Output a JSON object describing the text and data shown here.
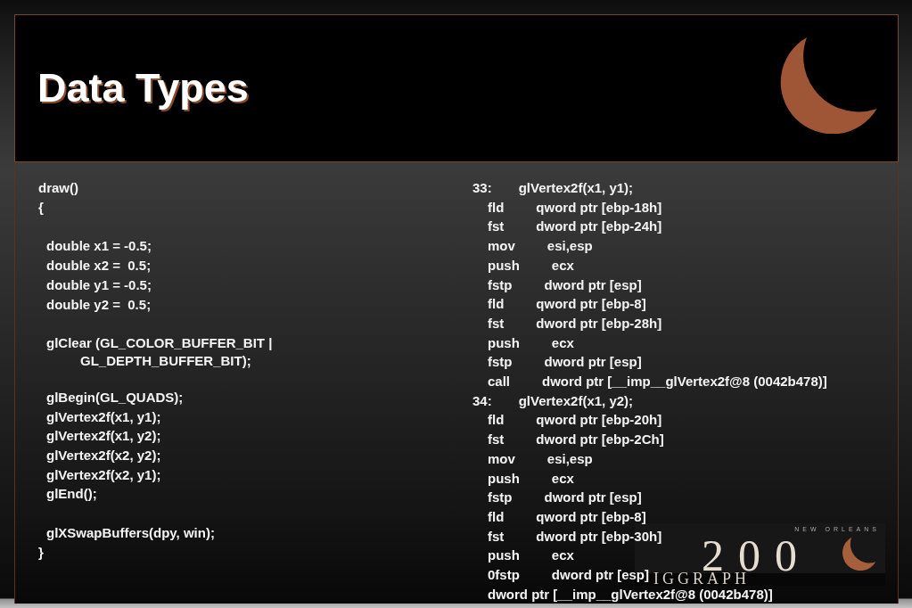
{
  "slide": {
    "title": "Data Types"
  },
  "source_code": {
    "signature": "draw()",
    "open_brace": "{",
    "groups": [
      {
        "lines": [
          {
            "text": "double x1 = -0.5;"
          },
          {
            "text": "double x2 =  0.5;"
          },
          {
            "text": "double y1 = -0.5;"
          },
          {
            "text": "double y2 =  0.5;"
          }
        ]
      },
      {
        "lines": [
          {
            "text": "glClear (GL_COLOR_BUFFER_BIT |",
            "children": [
              {
                "text": "GL_DEPTH_BUFFER_BIT);"
              }
            ]
          }
        ]
      },
      {
        "lines": [
          {
            "text": "glBegin(GL_QUADS);"
          },
          {
            "text": "glVertex2f(x1, y1);"
          },
          {
            "text": "glVertex2f(x1, y2);"
          },
          {
            "text": "glVertex2f(x2, y2);"
          },
          {
            "text": "glVertex2f(x2, y1);"
          },
          {
            "text": "glEnd();"
          }
        ]
      },
      {
        "lines": [
          {
            "text": "glXSwapBuffers(dpy, win);"
          }
        ]
      }
    ],
    "close_brace": "}"
  },
  "disassembly": {
    "sections": [
      {
        "line_number": "33:",
        "source": "glVertex2f(x1, y1);",
        "instructions": [
          {
            "mnemonic": "fld",
            "operand": "qword ptr [ebp-18h]"
          },
          {
            "mnemonic": "fst",
            "operand": "dword ptr [ebp-24h]"
          },
          {
            "mnemonic": "mov",
            "operand": "esi,esp"
          },
          {
            "mnemonic": "push",
            "operand": "ecx"
          },
          {
            "mnemonic": "fstp",
            "operand": "dword ptr [esp]"
          },
          {
            "mnemonic": "fld",
            "operand": "qword ptr [ebp-8]"
          },
          {
            "mnemonic": "fst",
            "operand": "dword ptr [ebp-28h]"
          },
          {
            "mnemonic": "push",
            "operand": "ecx"
          },
          {
            "mnemonic": "fstp",
            "operand": "dword ptr [esp]"
          },
          {
            "mnemonic": "call",
            "operand": "dword ptr [__imp__glVertex2f@8 (0042b478)]"
          }
        ]
      },
      {
        "line_number": "34:",
        "source": "glVertex2f(x1, y2);",
        "instructions": [
          {
            "mnemonic": "fld",
            "operand": "qword ptr [ebp-20h]"
          },
          {
            "mnemonic": "fst",
            "operand": "dword ptr [ebp-2Ch]"
          },
          {
            "mnemonic": "mov",
            "operand": "esi,esp"
          },
          {
            "mnemonic": "push",
            "operand": "ecx"
          },
          {
            "mnemonic": "fstp",
            "operand": "dword ptr [esp]"
          },
          {
            "mnemonic": "fld",
            "operand": "qword ptr [ebp-8]"
          },
          {
            "mnemonic": "fst",
            "operand": "dword ptr [ebp-30h]"
          },
          {
            "mnemonic": "push",
            "operand": "ecx"
          },
          {
            "mnemonic": "0fstp",
            "operand": "dword ptr [esp]"
          },
          {
            "operand": "dword ptr [__imp__glVertex2f@8 (0042b478)]"
          }
        ]
      }
    ]
  },
  "logo": {
    "region": "NEW ORLEANS",
    "year": "200",
    "name": "IGGRAPH"
  }
}
